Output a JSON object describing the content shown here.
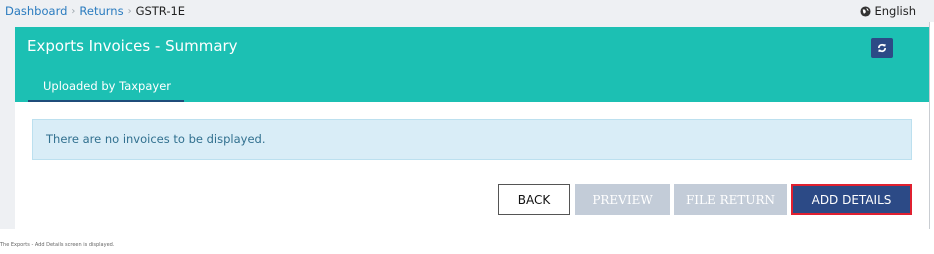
{
  "breadcrumb": {
    "items": [
      "Dashboard",
      "Returns"
    ],
    "current": "GSTR-1E",
    "separator": "›"
  },
  "language": {
    "label": "English",
    "icon": "globe-icon"
  },
  "panel": {
    "title": "Exports Invoices - Summary",
    "refresh_icon": "refresh-icon",
    "header_color": "#1cc0b3",
    "tabs": [
      {
        "label": "Uploaded by Taxpayer",
        "active": true
      }
    ],
    "info_message": "There are no invoices to be displayed."
  },
  "buttons": {
    "back": "BACK",
    "preview": "PREVIEW",
    "file_return": "FILE RETURN",
    "add_details": "ADD DETAILS"
  },
  "colors": {
    "primary": "#2c4a86",
    "disabled": "#c3ccd8",
    "highlight": "#e02030",
    "link": "#2a7bbf"
  },
  "caption": "The Exports - Add Details screen is displayed."
}
